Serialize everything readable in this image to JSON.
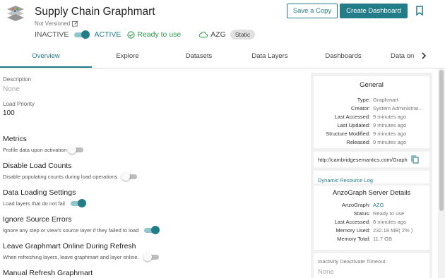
{
  "header": {
    "title": "Supply Chain Graphmart",
    "version_label": "Not Versioned",
    "status_inactive": "INACTIVE",
    "status_active": "ACTIVE",
    "ready_text": "Ready to use",
    "engine": "AZG",
    "engine_badge": "Static",
    "save_copy_label": "Save a Copy",
    "create_dashboard_label": "Create Dashboard"
  },
  "tabs": [
    {
      "label": "Overview",
      "active": true
    },
    {
      "label": "Explore",
      "active": false
    },
    {
      "label": "Datasets",
      "active": false
    },
    {
      "label": "Data Layers",
      "active": false
    },
    {
      "label": "Dashboards",
      "active": false
    },
    {
      "label": "Data on",
      "active": false
    }
  ],
  "overview": {
    "description_label": "Description",
    "description_value": "None",
    "load_priority_label": "Load Priority",
    "load_priority_value": "100",
    "sections": [
      {
        "title": "Metrics",
        "desc": "Profile data upon activation",
        "enabled": false
      },
      {
        "title": "Disable Load Counts",
        "desc": "Disable populating counts during load operations",
        "enabled": false
      },
      {
        "title": "Data Loading Settings",
        "desc": "Load layers that do not fail",
        "enabled": true
      },
      {
        "title": "Ignore Source Errors",
        "desc": "Ignore any step or view's source layer if they failed to load",
        "enabled": true
      },
      {
        "title": "Leave Graphmart Online During Refresh",
        "desc": "When refreshing layers, leave graphmart and layer online.",
        "enabled": false
      },
      {
        "title": "Manual Refresh Graphmart",
        "desc": "",
        "enabled": false
      }
    ]
  },
  "general": {
    "title": "General",
    "rows": [
      {
        "key": "Type",
        "value": "Graphmart"
      },
      {
        "key": "Creator",
        "value": "System Administrat..."
      },
      {
        "key": "Last Accessed",
        "value": "9 minutes ago"
      },
      {
        "key": "Last Updated",
        "value": "9 minutes ago"
      },
      {
        "key": "Structure Modified",
        "value": "9 minutes ago"
      },
      {
        "key": "Released",
        "value": "9 minutes ago"
      }
    ],
    "uri": "http://cambridgesemantics.com/Graph",
    "resource_log_label": "Dynamic Resource Log"
  },
  "anzograph": {
    "title": "AnzoGraph Server Details",
    "rows": [
      {
        "key": "AnzoGraph",
        "value": "AZG",
        "link": true
      },
      {
        "key": "Status",
        "value": "Ready to use",
        "link": false
      },
      {
        "key": "Last Accessed",
        "value": "8 minutes ago",
        "link": false
      },
      {
        "key": "Memory Used",
        "value": "232.18 MB( 2% )",
        "link": false
      },
      {
        "key": "Memory Total",
        "value": "11.7 GB",
        "link": false
      }
    ]
  },
  "inactivity": {
    "label": "Inactivity Deactivate Timeout",
    "value": "None"
  },
  "colors": {
    "accent": "#237d89",
    "ready": "#2e9a4a"
  }
}
